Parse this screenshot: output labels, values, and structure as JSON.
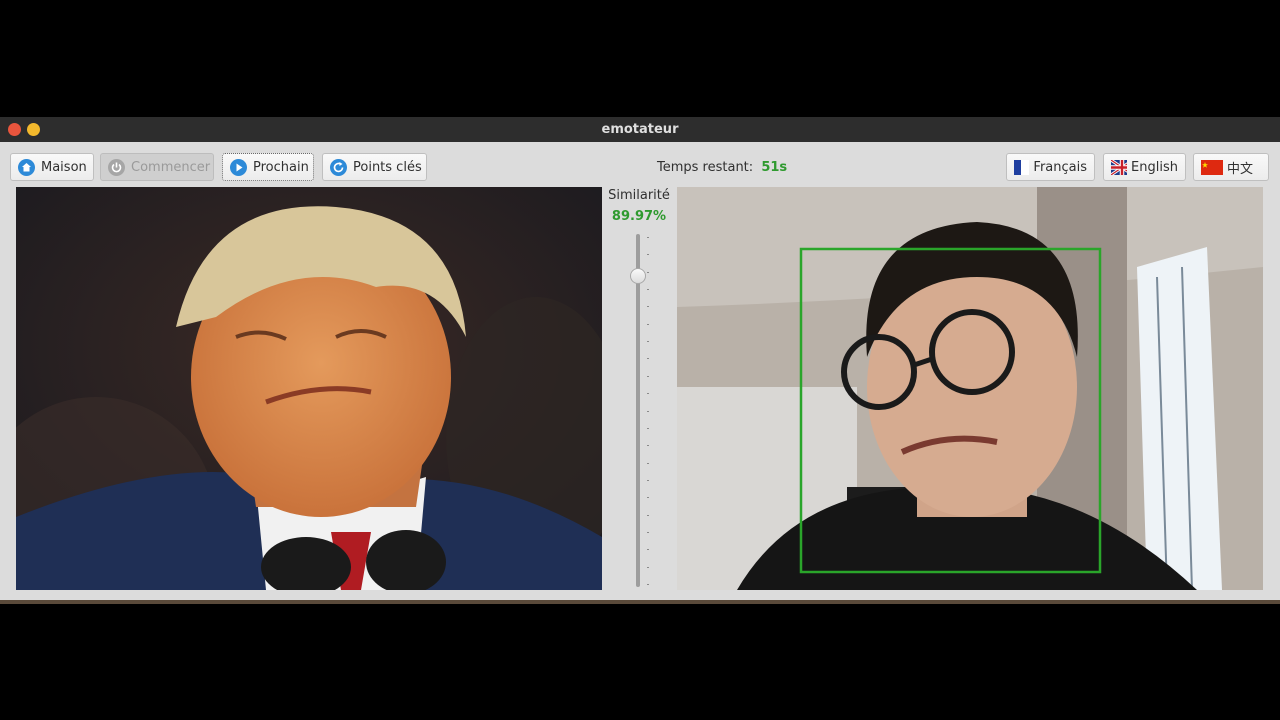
{
  "window": {
    "title": "emotateur"
  },
  "toolbar": {
    "home_label": "Maison",
    "start_label": "Commencer",
    "next_label": "Prochain",
    "keypoints_label": "Points clés"
  },
  "timer": {
    "label": "Temps restant:",
    "value": "51s"
  },
  "languages": {
    "french": "Français",
    "english": "English",
    "chinese": "中文"
  },
  "similarity": {
    "label": "Similarité",
    "value": "89.97%",
    "slider_fraction": 0.9
  },
  "colors": {
    "accent_green": "#2f9a2f",
    "icon_blue": "#2d8ad8",
    "face_box": "#2aa52a"
  }
}
